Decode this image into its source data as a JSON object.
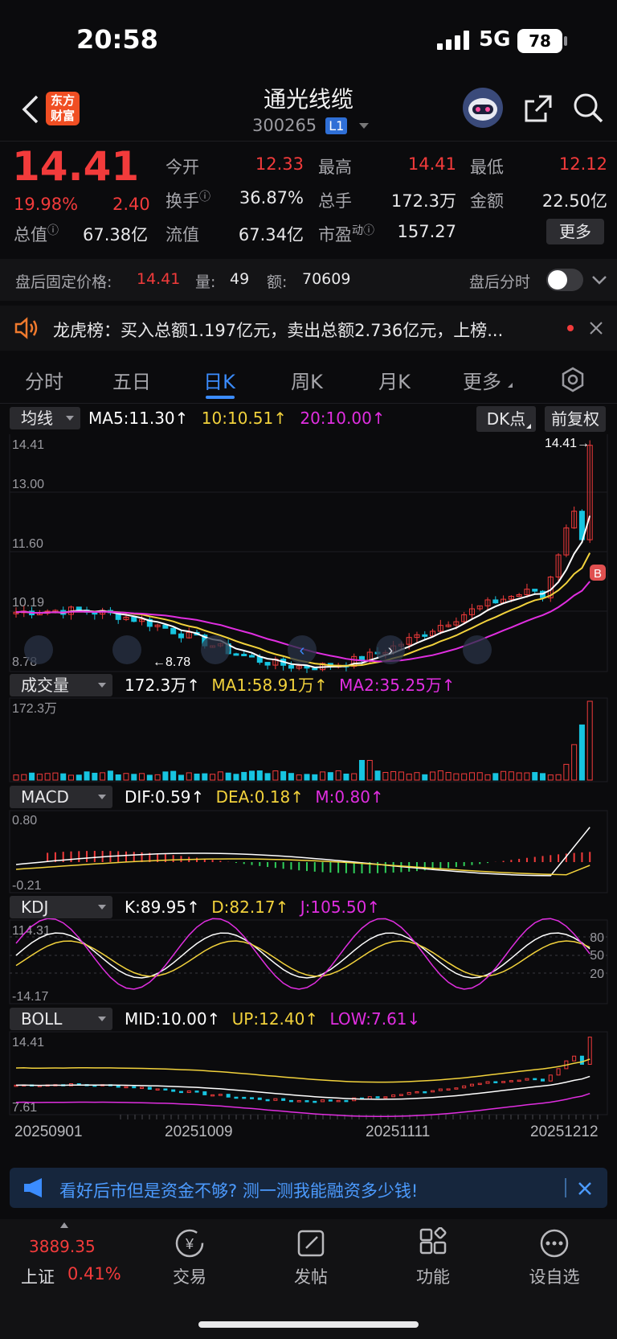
{
  "status_bar": {
    "time": "20:58",
    "network": "5G",
    "battery": "78"
  },
  "header": {
    "brand_line1": "东方",
    "brand_line2": "财富",
    "title": "通光线缆",
    "code": "300265",
    "level_badge": "L1"
  },
  "quote": {
    "price": "14.41",
    "change_pct": "19.98%",
    "change": "2.40",
    "open_label": "今开",
    "open": "12.33",
    "high_label": "最高",
    "high": "14.41",
    "low_label": "最低",
    "low": "12.12",
    "turnover_label": "换手",
    "turnover": "36.87%",
    "volume_label": "总手",
    "volume": "172.3万",
    "amount_label": "金额",
    "amount": "22.50亿",
    "mktcap_label": "总值",
    "mktcap": "67.38亿",
    "float_label": "流值",
    "float": "67.34亿",
    "pe_label": "市盈",
    "pe_sup": "动",
    "pe": "157.27",
    "more": "更多"
  },
  "after_hours": {
    "price_label": "盘后固定价格:",
    "price": "14.41",
    "qty_label": "量:",
    "qty": "49",
    "amt_label": "额:",
    "amt": "70609",
    "toggle_label": "盘后分时"
  },
  "notice": {
    "text": "龙虎榜：买入总额1.197亿元，卖出总额2.736亿元，上榜..."
  },
  "tabs": [
    "分时",
    "五日",
    "日K",
    "周K",
    "月K",
    "更多"
  ],
  "active_tab": "日K",
  "kline": {
    "indicator": "均线",
    "ma5": "MA5:11.30↑",
    "ma10": "10:10.51↑",
    "ma20": "20:10.00↑",
    "dk": "DK点",
    "adjust": "前复权",
    "y_max": "14.41",
    "y_13": "13.00",
    "y_116": "11.60",
    "y_1019": "10.19",
    "y_min": "8.78",
    "max_marker": "14.41→",
    "min_marker": "←8.78",
    "signal": "B"
  },
  "volume_panel": {
    "indicator": "成交量",
    "vol": "172.3万↑",
    "ma1": "MA1:58.91万↑",
    "ma2": "MA2:35.25万↑",
    "y_max": "172.3万"
  },
  "macd_panel": {
    "indicator": "MACD",
    "dif": "DIF:0.59↑",
    "dea": "DEA:0.18↑",
    "m": "M:0.80↑",
    "y_max": "0.80",
    "y_min": "-0.21"
  },
  "kdj_panel": {
    "indicator": "KDJ",
    "k": "K:89.95↑",
    "d": "D:82.17↑",
    "j": "J:105.50↑",
    "y_max": "114.31",
    "y_min": "-14.17",
    "lvl80": "80",
    "lvl50": "50",
    "lvl20": "20"
  },
  "boll_panel": {
    "indicator": "BOLL",
    "mid": "MID:10.00↑",
    "up": "UP:12.40↑",
    "low": "LOW:7.61↓",
    "y_max": "14.41",
    "y_min": "7.61"
  },
  "dates": [
    "20250901",
    "20251009",
    "20251111",
    "20251212"
  ],
  "promo": {
    "text": "看好后市但是资金不够? 测一测我能融资多少钱!"
  },
  "bottom_nav": {
    "index_value": "3889.35",
    "index_name": "上证",
    "index_pct": "0.41%",
    "items": [
      "交易",
      "发帖",
      "功能",
      "设自选"
    ]
  },
  "colors": {
    "up": "#f23b3b",
    "down": "#17c4e0",
    "ma5": "#ffffff",
    "ma10": "#f2d23c",
    "ma20": "#e02ee0",
    "accent": "#3b8cff"
  }
}
